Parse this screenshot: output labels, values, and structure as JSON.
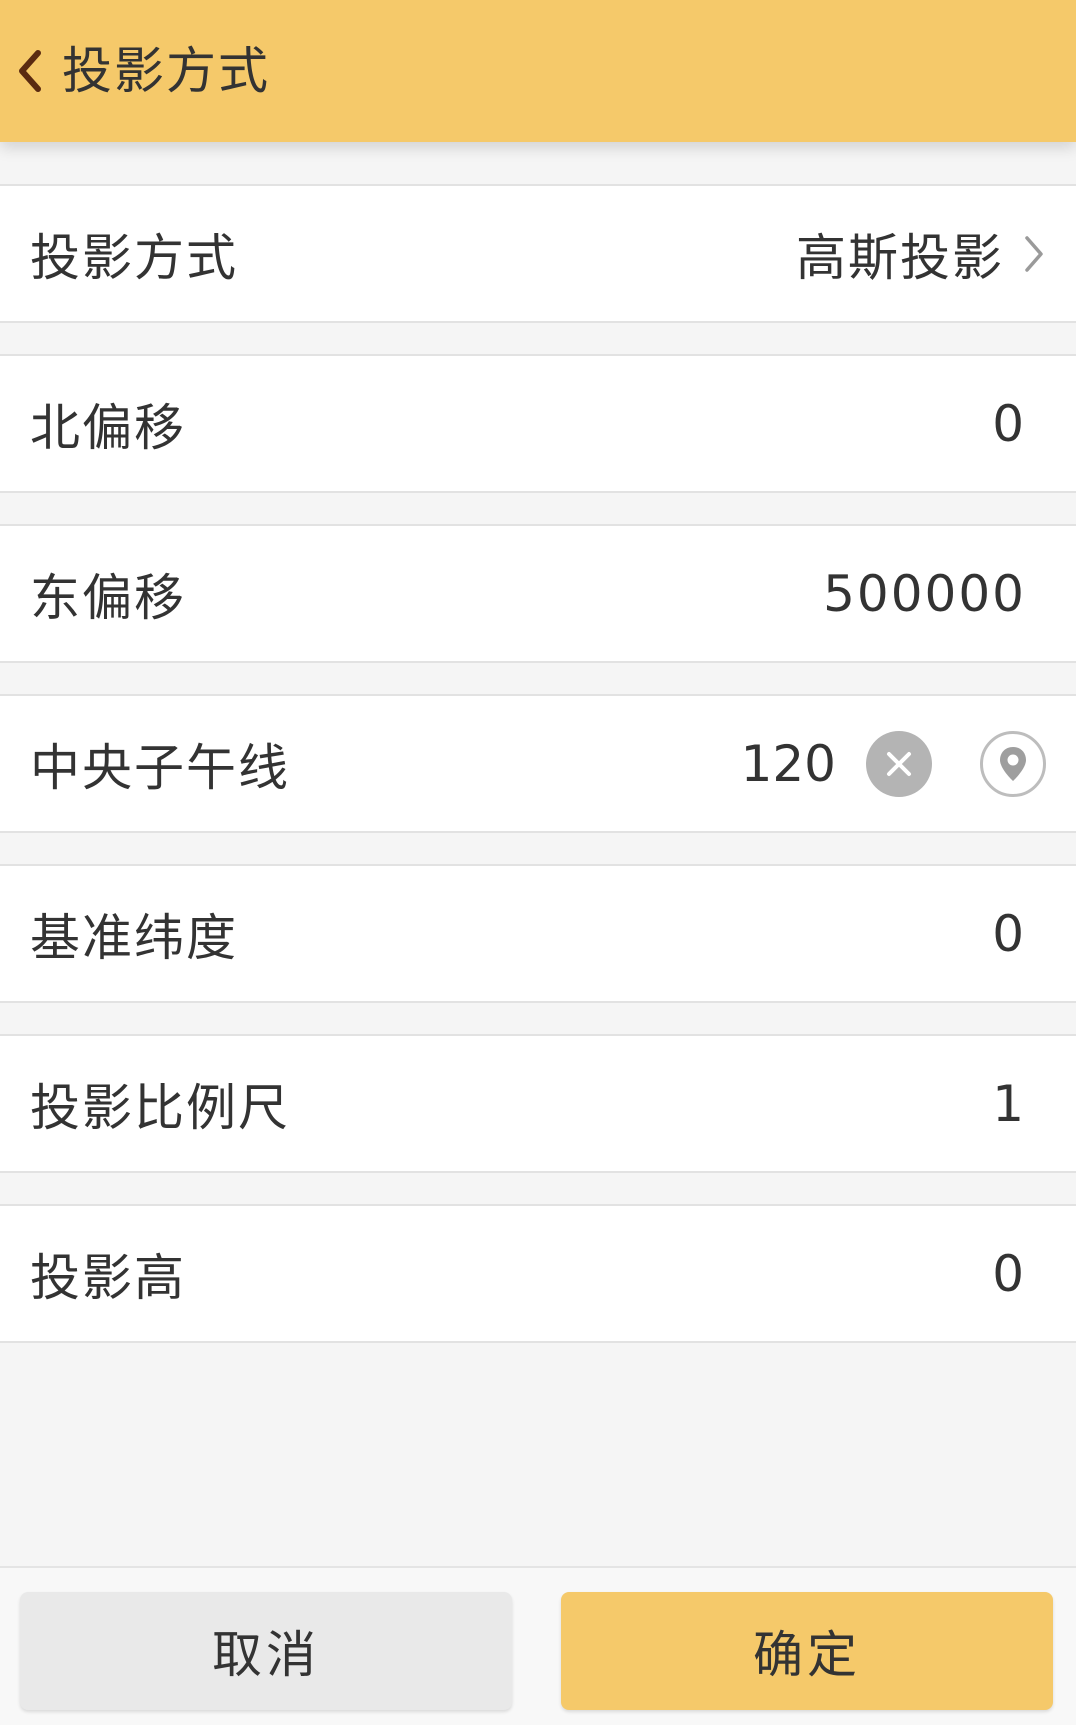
{
  "colors": {
    "header_bg": "#f5c96a",
    "confirm_bg": "#f5c96a",
    "cancel_bg": "#e9e9e9",
    "page_bg": "#f5f5f5",
    "text": "#333333",
    "back_icon": "#5a2a10"
  },
  "header": {
    "title": "投影方式",
    "back_icon": "chevron-left-icon"
  },
  "rows": [
    {
      "label": "投影方式",
      "value": "高斯投影",
      "type": "select",
      "icon": "chevron-right-icon"
    },
    {
      "label": "北偏移",
      "value": "0"
    },
    {
      "label": "东偏移",
      "value": "500000"
    },
    {
      "label": "中央子午线",
      "value": "120",
      "type": "input",
      "clear_icon": "clear-icon",
      "locate_icon": "location-pin-icon"
    },
    {
      "label": "基准纬度",
      "value": "0"
    },
    {
      "label": "投影比例尺",
      "value": "1"
    },
    {
      "label": "投影高",
      "value": "0"
    }
  ],
  "footer": {
    "cancel_label": "取消",
    "confirm_label": "确定"
  }
}
